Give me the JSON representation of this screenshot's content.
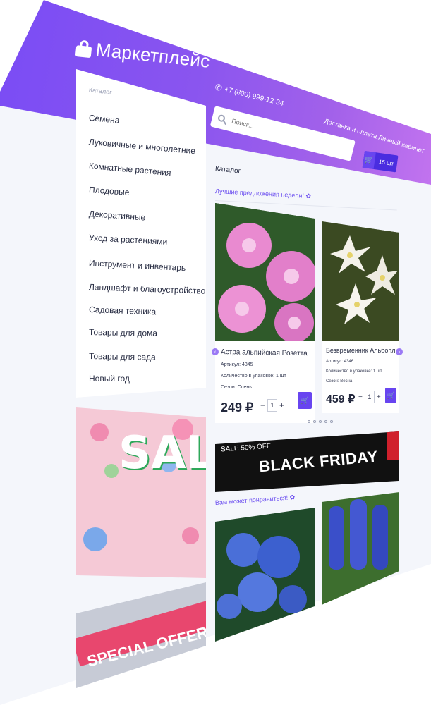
{
  "header": {
    "logo_text": "Маркетплейс",
    "phone": "+7 (800) 999-12-34",
    "delivery": "Доставка и оплата   Личный кабинет",
    "search_placeholder": "Поиск...",
    "cart_count": "15 шт"
  },
  "sidebar": {
    "title": "Каталог",
    "items": [
      {
        "label": "Семена"
      },
      {
        "label": "Луковичные и многолетние"
      },
      {
        "label": "Комнатные растения"
      },
      {
        "label": "Плодовые"
      },
      {
        "label": "Декоративные"
      },
      {
        "label": "Уход за растениями"
      },
      {
        "label": "Инструмент и инвентарь"
      },
      {
        "label": "Ландшафт и благоустройство"
      },
      {
        "label": "Садовая техника"
      },
      {
        "label": "Товары для дома"
      },
      {
        "label": "Товары для сада"
      },
      {
        "label": "Новый год"
      }
    ]
  },
  "main": {
    "breadcrumb": "Каталог",
    "offers_title": "Лучшие предложения недели!",
    "recommend_title": "Вам может понравиться!",
    "products": [
      {
        "name": "Астра альпийская Розетта",
        "article": "Артикул: 4345",
        "pack": "Количество в упаковке: 1 шт",
        "season": "Сезон: Осень",
        "price": "249 ₽",
        "qty": "1"
      },
      {
        "name": "Безвременник Альбоплинум",
        "article": "Артикул: 4346",
        "pack": "Количество в упаковке: 1 шт",
        "season": "Сезон: Весна",
        "price": "459 ₽",
        "qty": "1"
      }
    ],
    "banner": {
      "sale_text": "SALE 50% OFF",
      "title": "BLACK FRIDAY"
    }
  },
  "promo": {
    "sale_word": "SALE",
    "special_offer": "SPECIAL OFFER"
  },
  "colors": {
    "accent": "#6845f0",
    "header_start": "#7a4cf5",
    "header_end": "#c374ef"
  }
}
